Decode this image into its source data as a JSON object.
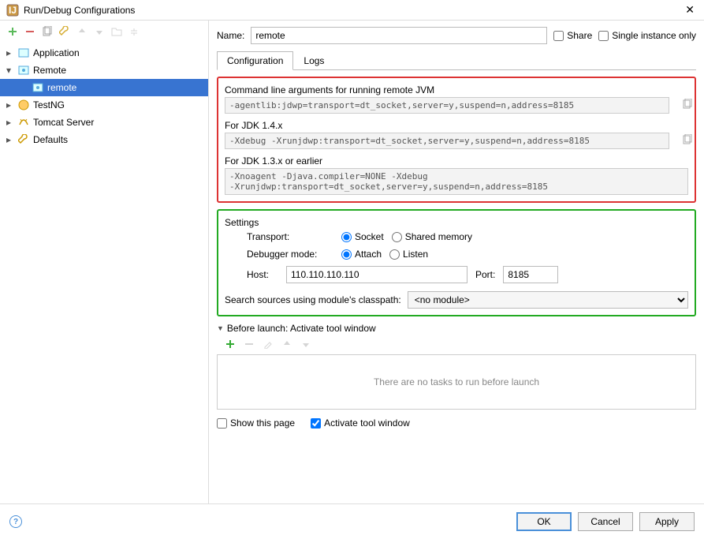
{
  "window": {
    "title": "Run/Debug Configurations"
  },
  "tree": {
    "items": [
      {
        "label": "Application",
        "expanded": false
      },
      {
        "label": "Remote",
        "expanded": true,
        "children": [
          {
            "label": "remote",
            "selected": true
          }
        ]
      },
      {
        "label": "TestNG",
        "expanded": false
      },
      {
        "label": "Tomcat Server",
        "expanded": false
      },
      {
        "label": "Defaults",
        "expanded": false
      }
    ]
  },
  "name": {
    "label": "Name:",
    "value": "remote"
  },
  "share": {
    "label": "Share",
    "checked": false
  },
  "single": {
    "label": "Single instance only",
    "checked": false
  },
  "tabs": {
    "configuration": "Configuration",
    "logs": "Logs"
  },
  "cmd": {
    "heading": "Command line arguments for running remote JVM",
    "main": "-agentlib:jdwp=transport=dt_socket,server=y,suspend=n,address=8185",
    "jdk14_label": "For JDK 1.4.x",
    "jdk14": "-Xdebug -Xrunjdwp:transport=dt_socket,server=y,suspend=n,address=8185",
    "jdk13_label": "For JDK 1.3.x or earlier",
    "jdk13": "-Xnoagent -Djava.compiler=NONE -Xdebug\n-Xrunjdwp:transport=dt_socket,server=y,suspend=n,address=8185"
  },
  "settings": {
    "heading": "Settings",
    "transport_label": "Transport:",
    "transport_socket": "Socket",
    "transport_shared": "Shared memory",
    "mode_label": "Debugger mode:",
    "mode_attach": "Attach",
    "mode_listen": "Listen",
    "host_label": "Host:",
    "host_value": "110.110.110.110",
    "port_label": "Port:",
    "port_value": "8185",
    "sources_label": "Search sources using module's classpath:",
    "sources_value": "<no module>"
  },
  "before": {
    "heading": "Before launch: Activate tool window",
    "empty": "There are no tasks to run before launch",
    "show_label": "Show this page",
    "show_checked": false,
    "activate_label": "Activate tool window",
    "activate_checked": true
  },
  "buttons": {
    "ok": "OK",
    "cancel": "Cancel",
    "apply": "Apply"
  }
}
